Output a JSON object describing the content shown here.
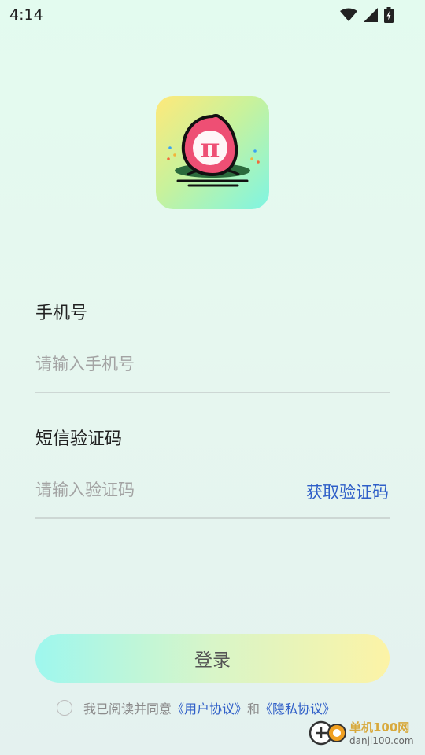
{
  "status_bar": {
    "time": "4:14",
    "icons": [
      "wifi-icon",
      "signal-icon",
      "battery-icon"
    ]
  },
  "logo": {
    "glyph": "π"
  },
  "phone": {
    "label": "手机号",
    "placeholder": "请输入手机号"
  },
  "code": {
    "label": "短信验证码",
    "placeholder": "请输入验证码",
    "get_code": "获取验证码"
  },
  "login": {
    "label": "登录"
  },
  "agreement": {
    "prefix": "我已阅读并同意",
    "user_agreement": "《用户协议》",
    "and": "和",
    "privacy": "《隐私协议》"
  },
  "watermark": {
    "name": "单机100网",
    "domain": "danji100.com"
  },
  "colors": {
    "accent": "#2f5fc8",
    "logo_fruit": "#ee4f74"
  }
}
